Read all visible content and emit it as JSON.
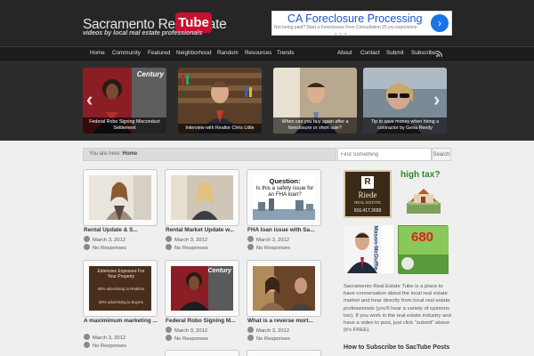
{
  "header": {
    "title": "Sacramento Real Estate",
    "title_badge": "Tube",
    "tagline": "videos by local real estate professionals"
  },
  "ad": {
    "title": "CA Foreclosure Processing",
    "subtitle": "Not being paid? Start a Foreclosure Free Consultation 25 yrs experience"
  },
  "nav": {
    "left": [
      "Home",
      "Community",
      "Featured",
      "Neighborhood",
      "Random",
      "Resources",
      "Trends"
    ],
    "right": [
      "About",
      "Contact",
      "Submit",
      "Subscribe"
    ]
  },
  "slider": {
    "slides": [
      {
        "caption": "Federal Robo Signing Misconduct Settlement",
        "logo": "Century"
      },
      {
        "caption": "Interview with Realtor Chris Little",
        "logo": ""
      },
      {
        "caption": "When can you buy again after a foreclosure or short sale?",
        "logo": ""
      },
      {
        "caption": "Tip to save money when hiring a contractor by Gena Reedy",
        "logo": ""
      }
    ]
  },
  "breadcrumb": {
    "prefix": "You are here:",
    "current": "Home"
  },
  "search": {
    "placeholder": "Find Something",
    "button": "Search"
  },
  "posts": [
    {
      "title": "Rental Update & S...",
      "date": "March 3, 2012",
      "comments": "No Responses"
    },
    {
      "title": "Rental Market Update w...",
      "date": "March 3, 2012",
      "comments": "No Responses"
    },
    {
      "title": "FHA loan issue with Sa...",
      "date": "March 3, 2012",
      "comments": "No Responses"
    },
    {
      "title": "A maximimum marketing ...",
      "date": "March 3, 2012",
      "comments": "No Responses"
    },
    {
      "title": "Federal Robo Signing M...",
      "date": "March 3, 2012",
      "comments": "No Responses"
    },
    {
      "title": "What is a reverse mort...",
      "date": "March 3, 2012",
      "comments": "No Responses"
    }
  ],
  "thumb_text": {
    "fha_question_title": "Question:",
    "fha_question_body": "Is this a safety issue for an FHA loan?",
    "marketing_line1": "Extensive Exposure For Your Property",
    "marketing_line2": "50% advertising to Realtors",
    "marketing_line3": "50% advertising to Buyers",
    "century": "Century"
  },
  "sidebar": {
    "riede_name": "Riede",
    "riede_sub": "REAL ESTATE",
    "riede_phone": "916.417.2699",
    "high_tax": "high tax?",
    "mason_name": "Mason-McDuffie",
    "ad680": "680",
    "about": "Sacramento Real Estate Tube is a place to have conversation about the local real estate market and hear directly from local real estate professionals (you'll hear a variety of opinions too). If you work in the real estate industry and have a video to post, just click \"submit\" above (it's FREE).",
    "subscribe_heading": "How to Subscribe to SacTube Posts"
  },
  "colors": {
    "brand_red": "#c8102e",
    "header_bg": "#262626",
    "nav_bg": "#1c1c1c",
    "ad_blue": "#1a55c8"
  }
}
